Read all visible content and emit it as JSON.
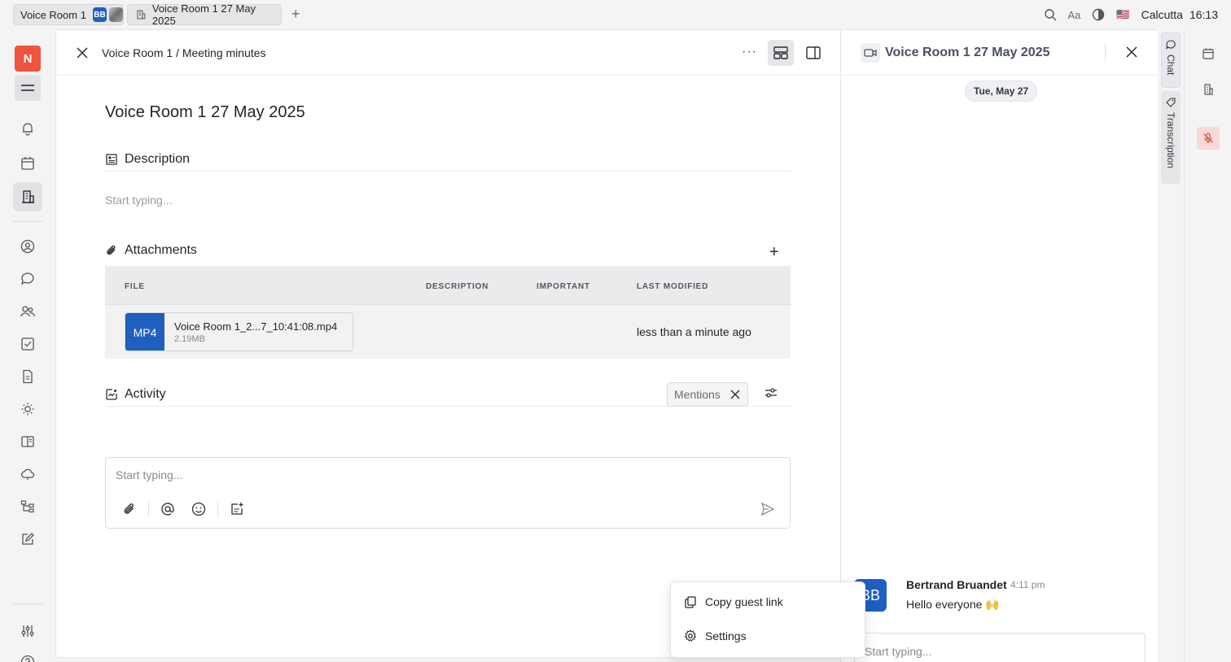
{
  "tabs": {
    "tab1_label": "Voice Room 1",
    "tab1_avatar": "BB",
    "tab2_label": "Voice Room 1 27 May 2025"
  },
  "topbar": {
    "font_label": "Aa",
    "flag": "🇺🇸",
    "location": "Calcutta",
    "time": "16:13"
  },
  "rail": {
    "logo": "N"
  },
  "main": {
    "breadcrumb": "Voice Room 1 / Meeting minutes",
    "title": "Voice Room 1 27 May 2025",
    "description_heading": "Description",
    "description_placeholder": "Start typing...",
    "attachments_heading": "Attachments",
    "table": {
      "columns": [
        "FILE",
        "DESCRIPTION",
        "IMPORTANT",
        "LAST MODIFIED"
      ],
      "rows": [
        {
          "badge": "MP4",
          "name": "Voice Room 1_2...7_10:41:08.mp4",
          "size": "2.19MB",
          "modified": "less than a minute ago"
        }
      ]
    },
    "activity_heading": "Activity",
    "mentions_label": "Mentions",
    "composer_placeholder": "Start typing..."
  },
  "context_menu": {
    "items": [
      "Copy guest link",
      "Settings"
    ]
  },
  "chat": {
    "title": "Voice Room 1 27 May 2025",
    "date": "Tue, May 27",
    "message": {
      "avatar": "BB",
      "author": "Bertrand Bruandet",
      "time": "4:11 pm",
      "text": "Hello everyone 🙌"
    },
    "input_placeholder": "Start typing..."
  },
  "side_tabs": {
    "chat": "Chat",
    "transcription": "Transcription"
  }
}
